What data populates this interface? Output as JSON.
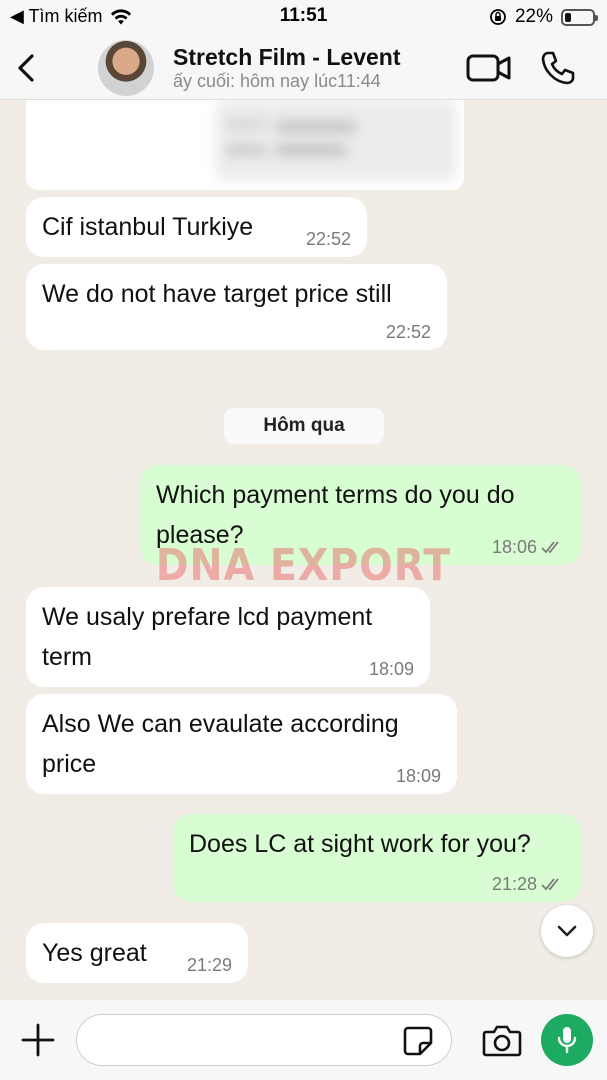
{
  "status_bar": {
    "back_label": "◀ Tìm kiếm",
    "time": "11:51",
    "battery_text": "22%",
    "battery_level": 0.22
  },
  "header": {
    "title": "Stretch Film - Levent",
    "subtitle": "ấy cuối: hôm nay lúc11:44"
  },
  "messages": [
    {
      "text": "Cif istanbul Turkiye",
      "time": "22:52",
      "direction": "in"
    },
    {
      "text": "We do not have target price still",
      "time": "22:52",
      "direction": "in"
    },
    {
      "text": "Which payment terms do you do please?",
      "time": "18:06",
      "direction": "out",
      "read": true
    },
    {
      "text": "We usaly prefare lcd payment term",
      "time": "18:09",
      "direction": "in"
    },
    {
      "text": "Also We can evaulate according price",
      "time": "18:09",
      "direction": "in"
    },
    {
      "text": "Does LC at sight work for you?",
      "time": "21:28",
      "direction": "out",
      "read": true
    },
    {
      "text": "Yes great",
      "time": "21:29",
      "direction": "in"
    }
  ],
  "date_separator": "Hôm qua",
  "watermark": "DNA EXPORT",
  "input": {
    "placeholder": ""
  },
  "colors": {
    "incoming_bubble": "#ffffff",
    "outgoing_bubble": "#d9fdd3",
    "chat_background": "#f1ede6",
    "mic_button": "#1daa61",
    "read_ticks": "#7a7a7a"
  }
}
